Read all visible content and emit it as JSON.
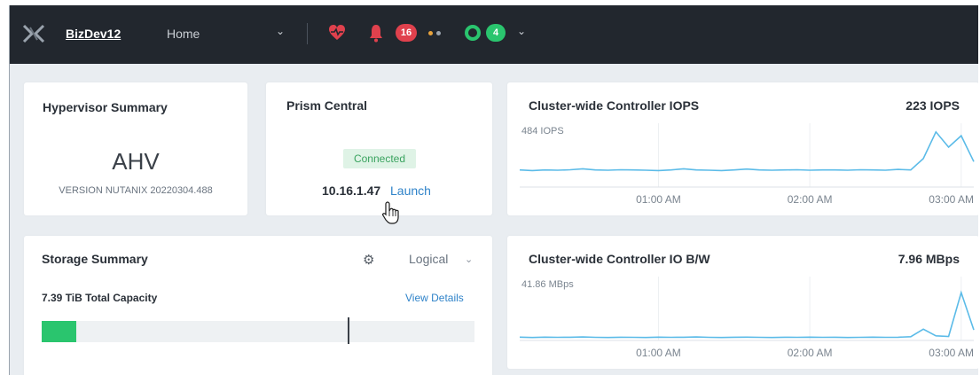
{
  "topbar": {
    "cluster_name": "BizDev12",
    "nav_home": "Home",
    "home_caret": "⌄",
    "alerts_count": "16",
    "tasks_count": "4",
    "menu_caret": "⌄",
    "icons": [
      "nutanix-logo-icon",
      "health-heart-icon",
      "alert-bell-icon",
      "tasks-ring-icon"
    ],
    "colors": {
      "alert": "#e0414d",
      "health": "#e0414d",
      "ok": "#2ac56e",
      "warn": "#e8a33c",
      "neutral": "#9aa3ad"
    }
  },
  "hypervisor": {
    "title": "Hypervisor Summary",
    "name": "AHV",
    "version": "VERSION NUTANIX 20220304.488"
  },
  "prism_central": {
    "title": "Prism Central",
    "status": "Connected",
    "ip": "10.16.1.47",
    "launch_label": "Launch"
  },
  "storage": {
    "title": "Storage Summary",
    "view_mode": "Logical",
    "view_caret": "⌄",
    "gear_glyph": "⚙",
    "capacity_label": "7.39 TiB Total Capacity",
    "view_details_label": "View Details",
    "used_fraction": 0.08,
    "threshold_fraction": 0.706
  },
  "chart_data": [
    {
      "type": "line",
      "title": "Cluster-wide Controller IOPS",
      "current_value": "223 IOPS",
      "peak_label": "484 IOPS",
      "x_ticks": [
        "01:00 AM",
        "02:00 AM",
        "03:00 AM"
      ],
      "x": [
        "00:05",
        "00:10",
        "00:15",
        "00:20",
        "00:25",
        "00:30",
        "00:35",
        "00:40",
        "00:45",
        "00:50",
        "00:55",
        "01:00",
        "01:05",
        "01:10",
        "01:15",
        "01:20",
        "01:25",
        "01:30",
        "01:35",
        "01:40",
        "01:45",
        "01:50",
        "01:55",
        "02:00",
        "02:05",
        "02:10",
        "02:15",
        "02:20",
        "02:25",
        "02:30",
        "02:35",
        "02:40",
        "02:45",
        "02:50",
        "02:55",
        "03:00",
        "03:05"
      ],
      "series": [
        {
          "values": [
            150,
            145,
            150,
            148,
            152,
            160,
            150,
            148,
            152,
            150,
            148,
            145,
            150,
            160,
            150,
            148,
            145,
            150,
            158,
            150,
            148,
            150,
            152,
            148,
            150,
            150,
            148,
            152,
            150,
            148,
            155,
            150,
            250,
            484,
            350,
            450,
            223
          ]
        }
      ],
      "ylim": [
        0,
        560
      ],
      "color": "#5bbbe8",
      "grid": true
    },
    {
      "type": "line",
      "title": "Cluster-wide Controller IO B/W",
      "current_value": "7.96 MBps",
      "peak_label": "41.86 MBps",
      "x_ticks": [
        "01:00 AM",
        "02:00 AM",
        "03:00 AM"
      ],
      "x": [
        "00:05",
        "00:10",
        "00:15",
        "00:20",
        "00:25",
        "00:30",
        "00:35",
        "00:40",
        "00:45",
        "00:50",
        "00:55",
        "01:00",
        "01:05",
        "01:10",
        "01:15",
        "01:20",
        "01:25",
        "01:30",
        "01:35",
        "01:40",
        "01:45",
        "01:50",
        "01:55",
        "02:00",
        "02:05",
        "02:10",
        "02:15",
        "02:20",
        "02:25",
        "02:30",
        "02:35",
        "02:40",
        "02:45",
        "02:50",
        "02:55",
        "03:00",
        "03:05"
      ],
      "series": [
        {
          "values": [
            2.5,
            2.2,
            2.5,
            2.3,
            2.4,
            2.6,
            2.3,
            2.2,
            2.4,
            2.3,
            2.2,
            2.5,
            2.3,
            2.4,
            2.6,
            2.3,
            2.2,
            2.4,
            2.5,
            2.3,
            2.2,
            2.4,
            2.3,
            2.5,
            2.3,
            2.4,
            2.2,
            2.3,
            2.5,
            2.3,
            2.4,
            2.8,
            8.5,
            3.5,
            3.0,
            36.0,
            7.96
          ]
        }
      ],
      "ylim": [
        0,
        48
      ],
      "color": "#5bbbe8",
      "grid": true
    }
  ]
}
